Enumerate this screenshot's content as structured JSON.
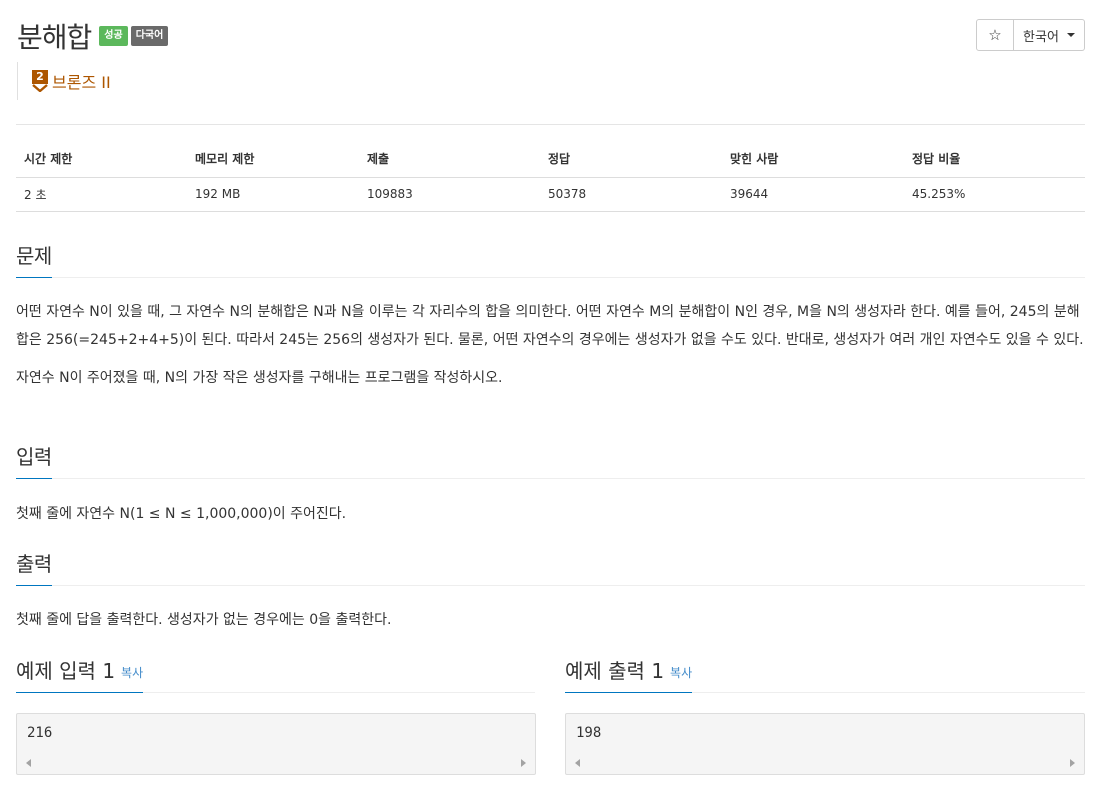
{
  "problem": {
    "title": "분해합",
    "labels": {
      "success": "성공",
      "multilang": "다국어"
    },
    "tier": {
      "number": "2",
      "text": "브론즈 II"
    }
  },
  "toolbar": {
    "star": "☆",
    "language": "한국어"
  },
  "info_table": {
    "headers": [
      "시간 제한",
      "메모리 제한",
      "제출",
      "정답",
      "맞힌 사람",
      "정답 비율"
    ],
    "values": [
      "2 초",
      "192 MB",
      "109883",
      "50378",
      "39644",
      "45.253%"
    ]
  },
  "sections": {
    "description": {
      "title": "문제",
      "paragraphs": [
        "어떤 자연수 N이 있을 때, 그 자연수 N의 분해합은 N과 N을 이루는 각 자리수의 합을 의미한다. 어떤 자연수 M의 분해합이 N인 경우, M을 N의 생성자라 한다. 예를 들어, 245의 분해합은 256(=245+2+4+5)이 된다. 따라서 245는 256의 생성자가 된다. 물론, 어떤 자연수의 경우에는 생성자가 없을 수도 있다. 반대로, 생성자가 여러 개인 자연수도 있을 수 있다.",
        "자연수 N이 주어졌을 때, N의 가장 작은 생성자를 구해내는 프로그램을 작성하시오."
      ]
    },
    "input": {
      "title": "입력",
      "text": "첫째 줄에 자연수 N(1 ≤ N ≤ 1,000,000)이 주어진다."
    },
    "output": {
      "title": "출력",
      "text": "첫째 줄에 답을 출력한다. 생성자가 없는 경우에는 0을 출력한다."
    }
  },
  "samples": {
    "input": {
      "title": "예제 입력 1",
      "copy": "복사",
      "value": "216"
    },
    "output": {
      "title": "예제 출력 1",
      "copy": "복사",
      "value": "198"
    }
  }
}
